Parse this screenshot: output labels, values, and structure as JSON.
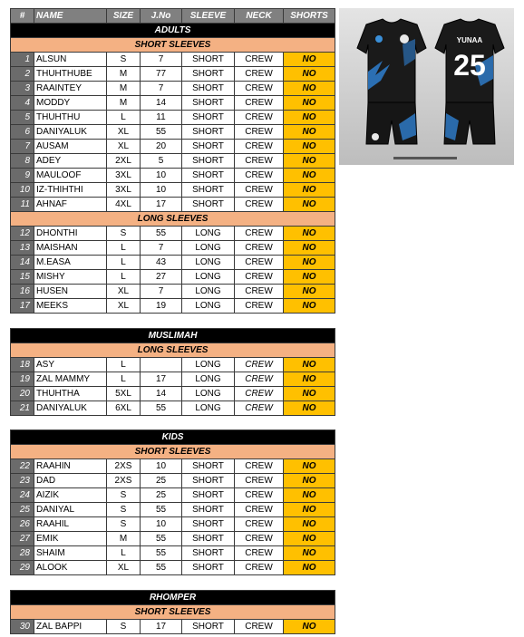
{
  "headers": [
    "#",
    "NAME",
    "SIZE",
    "J.No",
    "SLEEVE",
    "NECK",
    "SHORTS"
  ],
  "groups": [
    {
      "title": "ADULTS",
      "subsections": [
        {
          "title": "SHORT SLEEVES",
          "rows": [
            {
              "n": "1",
              "name": "ALSUN",
              "size": "S",
              "jno": "7",
              "sleeve": "SHORT",
              "neck": "CREW",
              "shorts": "NO"
            },
            {
              "n": "2",
              "name": "THUHTHUBE",
              "size": "M",
              "jno": "77",
              "sleeve": "SHORT",
              "neck": "CREW",
              "shorts": "NO"
            },
            {
              "n": "3",
              "name": "RAAINTEY",
              "size": "M",
              "jno": "7",
              "sleeve": "SHORT",
              "neck": "CREW",
              "shorts": "NO"
            },
            {
              "n": "4",
              "name": "MODDY",
              "size": "M",
              "jno": "14",
              "sleeve": "SHORT",
              "neck": "CREW",
              "shorts": "NO"
            },
            {
              "n": "5",
              "name": "THUHTHU",
              "size": "L",
              "jno": "11",
              "sleeve": "SHORT",
              "neck": "CREW",
              "shorts": "NO"
            },
            {
              "n": "6",
              "name": "DANIYALUK",
              "size": "XL",
              "jno": "55",
              "sleeve": "SHORT",
              "neck": "CREW",
              "shorts": "NO"
            },
            {
              "n": "7",
              "name": "AUSAM",
              "size": "XL",
              "jno": "20",
              "sleeve": "SHORT",
              "neck": "CREW",
              "shorts": "NO"
            },
            {
              "n": "8",
              "name": "ADEY",
              "size": "2XL",
              "jno": "5",
              "sleeve": "SHORT",
              "neck": "CREW",
              "shorts": "NO"
            },
            {
              "n": "9",
              "name": "MAULOOF",
              "size": "3XL",
              "jno": "10",
              "sleeve": "SHORT",
              "neck": "CREW",
              "shorts": "NO"
            },
            {
              "n": "10",
              "name": "IZ-THIHTHI",
              "size": "3XL",
              "jno": "10",
              "sleeve": "SHORT",
              "neck": "CREW",
              "shorts": "NO"
            },
            {
              "n": "11",
              "name": "AHNAF",
              "size": "4XL",
              "jno": "17",
              "sleeve": "SHORT",
              "neck": "CREW",
              "shorts": "NO"
            }
          ]
        },
        {
          "title": "LONG SLEEVES",
          "rows": [
            {
              "n": "12",
              "name": "DHONTHI",
              "size": "S",
              "jno": "55",
              "sleeve": "LONG",
              "neck": "CREW",
              "shorts": "NO"
            },
            {
              "n": "13",
              "name": "MAISHAN",
              "size": "L",
              "jno": "7",
              "sleeve": "LONG",
              "neck": "CREW",
              "shorts": "NO"
            },
            {
              "n": "14",
              "name": "M.EASA",
              "size": "L",
              "jno": "43",
              "sleeve": "LONG",
              "neck": "CREW",
              "shorts": "NO"
            },
            {
              "n": "15",
              "name": "MISHY",
              "size": "L",
              "jno": "27",
              "sleeve": "LONG",
              "neck": "CREW",
              "shorts": "NO"
            },
            {
              "n": "16",
              "name": "HUSEN",
              "size": "XL",
              "jno": "7",
              "sleeve": "LONG",
              "neck": "CREW",
              "shorts": "NO"
            },
            {
              "n": "17",
              "name": "MEEKS",
              "size": "XL",
              "jno": "19",
              "sleeve": "LONG",
              "neck": "CREW",
              "shorts": "NO"
            }
          ]
        }
      ]
    },
    {
      "title": "MUSLIMAH",
      "subsections": [
        {
          "title": "LONG SLEEVES",
          "rows": [
            {
              "n": "18",
              "name": "ASY",
              "size": "L",
              "jno": "",
              "sleeve": "LONG",
              "neck": "CREW",
              "shorts": "NO"
            },
            {
              "n": "19",
              "name": "ZAL MAMMY",
              "size": "L",
              "jno": "17",
              "sleeve": "LONG",
              "neck": "CREW",
              "shorts": "NO"
            },
            {
              "n": "20",
              "name": "THUHTHA",
              "size": "5XL",
              "jno": "14",
              "sleeve": "LONG",
              "neck": "CREW",
              "shorts": "NO"
            },
            {
              "n": "21",
              "name": "DANIYALUK",
              "size": "6XL",
              "jno": "55",
              "sleeve": "LONG",
              "neck": "CREW",
              "shorts": "NO"
            }
          ]
        }
      ]
    },
    {
      "title": "KIDS",
      "subsections": [
        {
          "title": "SHORT SLEEVES",
          "rows": [
            {
              "n": "22",
              "name": "RAAHIN",
              "size": "2XS",
              "jno": "10",
              "sleeve": "SHORT",
              "neck": "CREW",
              "shorts": "NO"
            },
            {
              "n": "23",
              "name": "DAD",
              "size": "2XS",
              "jno": "25",
              "sleeve": "SHORT",
              "neck": "CREW",
              "shorts": "NO"
            },
            {
              "n": "24",
              "name": "AIZIK",
              "size": "S",
              "jno": "25",
              "sleeve": "SHORT",
              "neck": "CREW",
              "shorts": "NO"
            },
            {
              "n": "25",
              "name": "DANIYAL",
              "size": "S",
              "jno": "55",
              "sleeve": "SHORT",
              "neck": "CREW",
              "shorts": "NO"
            },
            {
              "n": "26",
              "name": "RAAHIL",
              "size": "S",
              "jno": "10",
              "sleeve": "SHORT",
              "neck": "CREW",
              "shorts": "NO"
            },
            {
              "n": "27",
              "name": "EMIK",
              "size": "M",
              "jno": "55",
              "sleeve": "SHORT",
              "neck": "CREW",
              "shorts": "NO"
            },
            {
              "n": "28",
              "name": "SHAIM",
              "size": "L",
              "jno": "55",
              "sleeve": "SHORT",
              "neck": "CREW",
              "shorts": "NO"
            },
            {
              "n": "29",
              "name": "ALOOK",
              "size": "XL",
              "jno": "55",
              "sleeve": "SHORT",
              "neck": "CREW",
              "shorts": "NO"
            }
          ]
        }
      ]
    },
    {
      "title": "RHOMPER",
      "subsections": [
        {
          "title": "SHORT SLEEVES",
          "rows": [
            {
              "n": "30",
              "name": "ZAL BAPPI",
              "size": "S",
              "jno": "17",
              "sleeve": "SHORT",
              "neck": "CREW",
              "shorts": "NO"
            }
          ]
        }
      ]
    }
  ],
  "jersey_preview": {
    "player_name": "YUNAA",
    "number": "25"
  },
  "colors": {
    "header_bg": "#808080",
    "section_bg": "#000000",
    "subsection_bg": "#f4b183",
    "index_bg": "#6b6b6b",
    "shorts_bg": "#ffc000",
    "jersey_body": "#1a1a1a",
    "jersey_accent": "#3a8fd8"
  }
}
